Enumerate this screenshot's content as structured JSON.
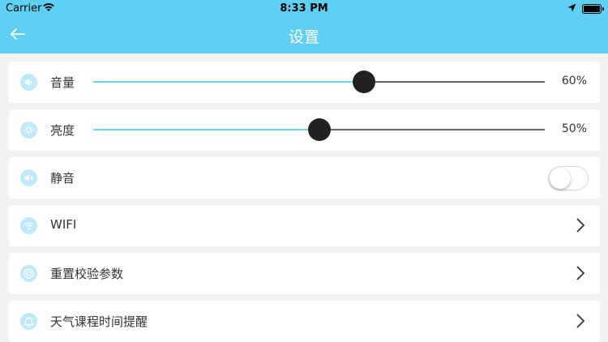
{
  "status_bar": {
    "carrier": "Carrier",
    "time": "8:33 PM"
  },
  "header": {
    "title": "设置"
  },
  "settings": {
    "volume": {
      "label": "音量",
      "value_text": "60%",
      "value": 0.6
    },
    "brightness": {
      "label": "亮度",
      "value_text": "50%",
      "value": 0.5
    },
    "mute": {
      "label": "静音",
      "on": false
    },
    "wifi": {
      "label": "WIFI"
    },
    "reset_calibration": {
      "label": "重置校验参数"
    },
    "reminder": {
      "label": "天气课程时间提醒"
    }
  },
  "colors": {
    "accent": "#5fd0f3",
    "icon_bg": "#bfe9f8",
    "background": "#f2f2f2"
  },
  "icons": [
    "wifi-signal-icon",
    "location-arrow-icon",
    "battery-icon",
    "back-arrow-icon",
    "volume-icon",
    "brightness-icon",
    "mute-icon",
    "wifi-icon",
    "reset-icon",
    "bell-icon",
    "chevron-right-icon"
  ]
}
